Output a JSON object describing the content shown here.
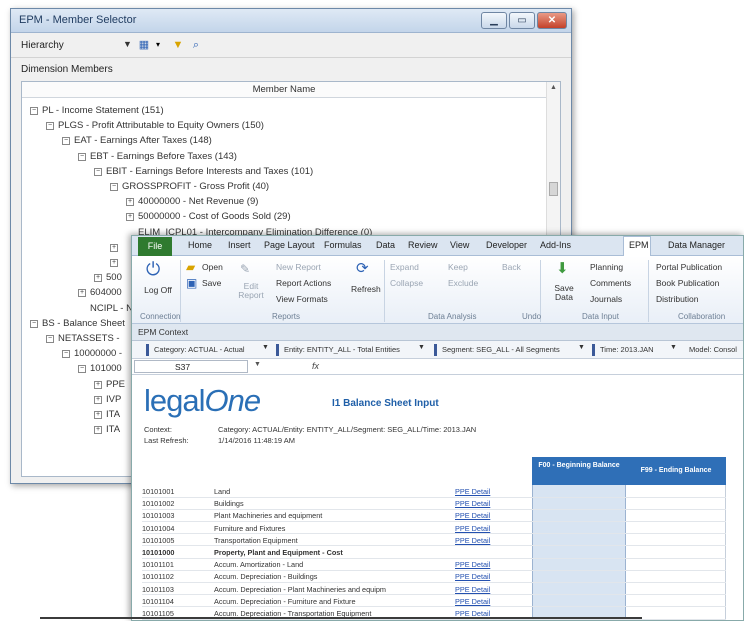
{
  "member_selector": {
    "title": "EPM - Member Selector",
    "hierarchy_label": "Hierarchy",
    "dimension_members_label": "Dimension Members",
    "column_header": "Member Name",
    "tree": [
      {
        "indent": 0,
        "toggle": "⊟",
        "label": "PL - Income Statement (151)"
      },
      {
        "indent": 1,
        "toggle": "⊟",
        "label": "PLGS - Profit Attributable to Equity Owners (150)"
      },
      {
        "indent": 2,
        "toggle": "⊟",
        "label": "EAT - Earnings After Taxes (148)"
      },
      {
        "indent": 3,
        "toggle": "⊟",
        "label": "EBT - Earnings Before Taxes (143)"
      },
      {
        "indent": 4,
        "toggle": "⊟",
        "label": "EBIT - Earnings Before Interests and Taxes (101)"
      },
      {
        "indent": 5,
        "toggle": "⊟",
        "label": "GROSSPROFIT - Gross Profit (40)"
      },
      {
        "indent": 6,
        "toggle": "⊞",
        "label": "40000000 - Net Revenue (9)"
      },
      {
        "indent": 6,
        "toggle": "⊞",
        "label": "50000000 - Cost of Goods Sold (29)"
      },
      {
        "indent": 6,
        "toggle": "",
        "label": "ELIM_ICPL01 - Intercompany Elimination Difference (0)"
      },
      {
        "indent": 5,
        "toggle": "⊞",
        "label": ""
      },
      {
        "indent": 5,
        "toggle": "⊞",
        "label": ""
      },
      {
        "indent": 4,
        "toggle": "⊞",
        "label": "500"
      },
      {
        "indent": 3,
        "toggle": "⊞",
        "label": "604000"
      },
      {
        "indent": 3,
        "toggle": "",
        "label": "NCIPL - Nor"
      },
      {
        "indent": 0,
        "toggle": "⊟",
        "label": "BS - Balance Sheet"
      },
      {
        "indent": 1,
        "toggle": "⊟",
        "label": "NETASSETS -"
      },
      {
        "indent": 2,
        "toggle": "⊟",
        "label": "10000000 -"
      },
      {
        "indent": 3,
        "toggle": "⊟",
        "label": "101000"
      },
      {
        "indent": 4,
        "toggle": "⊞",
        "label": "PPE"
      },
      {
        "indent": 4,
        "toggle": "⊞",
        "label": "IVP"
      },
      {
        "indent": 4,
        "toggle": "⊞",
        "label": "ITA"
      },
      {
        "indent": 4,
        "toggle": "⊞",
        "label": "ITA"
      }
    ]
  },
  "excel": {
    "tabs": [
      "File",
      "Home",
      "Insert",
      "Page Layout",
      "Formulas",
      "Data",
      "Review",
      "View",
      "Developer",
      "Add-Ins",
      "EPM",
      "Data Manager"
    ],
    "ribbon": {
      "log_off": "Log Off",
      "connection": "Connection",
      "open": "Open",
      "save": "Save",
      "edit_report": "Edit Report",
      "new_report": "New Report",
      "report_actions": "Report Actions",
      "view_formats": "View Formats",
      "refresh": "Refresh",
      "reports": "Reports",
      "expand": "Expand",
      "collapse": "Collapse",
      "keep": "Keep",
      "exclude": "Exclude",
      "back": "Back",
      "data_analysis": "Data Analysis",
      "undo": "Undo",
      "save_data": "Save Data",
      "planning": "Planning",
      "comments": "Comments",
      "journals": "Journals",
      "data_input": "Data Input",
      "portal_publication": "Portal Publication",
      "book_publication": "Book Publication",
      "distribution": "Distribution",
      "collaboration": "Collaboration"
    },
    "context_title": "EPM Context",
    "context": {
      "category": "Category: ACTUAL - Actual",
      "entity": "Entity: ENTITY_ALL - Total Entities",
      "segment": "Segment: SEG_ALL - All Segments",
      "time": "Time: 2013.JAN",
      "model": "Model: Consol"
    },
    "namebox": "S37",
    "fx": "fx",
    "logo_left": "legal",
    "logo_right": "One",
    "sheet_title": "I1 Balance Sheet Input",
    "context_label": "Context:",
    "context_value": "Category: ACTUAL/Entity: ENTITY_ALL/Segment: SEG_ALL/Time: 2013.JAN",
    "refresh_label": "Last Refresh:",
    "refresh_value": "1/14/2016 11:48:19 AM",
    "col_beginning": "F00 - Beginning Balance",
    "col_ending": "F99 - Ending Balance",
    "rows": [
      {
        "code": "10101001",
        "desc": "Land",
        "link": "PPE Detail",
        "bold": false
      },
      {
        "code": "10101002",
        "desc": "Buildings",
        "link": "PPE Detail",
        "bold": false
      },
      {
        "code": "10101003",
        "desc": "Plant Machineries and equipment",
        "link": "PPE Detail",
        "bold": false
      },
      {
        "code": "10101004",
        "desc": "Furniture and Fixtures",
        "link": "PPE Detail",
        "bold": false
      },
      {
        "code": "10101005",
        "desc": "Transportation Equipment",
        "link": "PPE Detail",
        "bold": false
      },
      {
        "code": "10101000",
        "desc": "Property, Plant and Equipment - Cost",
        "link": "",
        "bold": true
      },
      {
        "code": "10101101",
        "desc": "Accum. Amortization - Land",
        "link": "PPE Detail",
        "bold": false
      },
      {
        "code": "10101102",
        "desc": "Accum. Depreciation - Buildings",
        "link": "PPE Detail",
        "bold": false
      },
      {
        "code": "10101103",
        "desc": "Accum. Depreciation - Plant Machineries and equipm",
        "link": "PPE Detail",
        "bold": false
      },
      {
        "code": "10101104",
        "desc": "Accum. Depreciation - Furniture and Fixture",
        "link": "PPE Detail",
        "bold": false
      },
      {
        "code": "10101105",
        "desc": "Accum. Depreciation - Transportation Equipment",
        "link": "PPE Detail",
        "bold": false
      }
    ]
  }
}
